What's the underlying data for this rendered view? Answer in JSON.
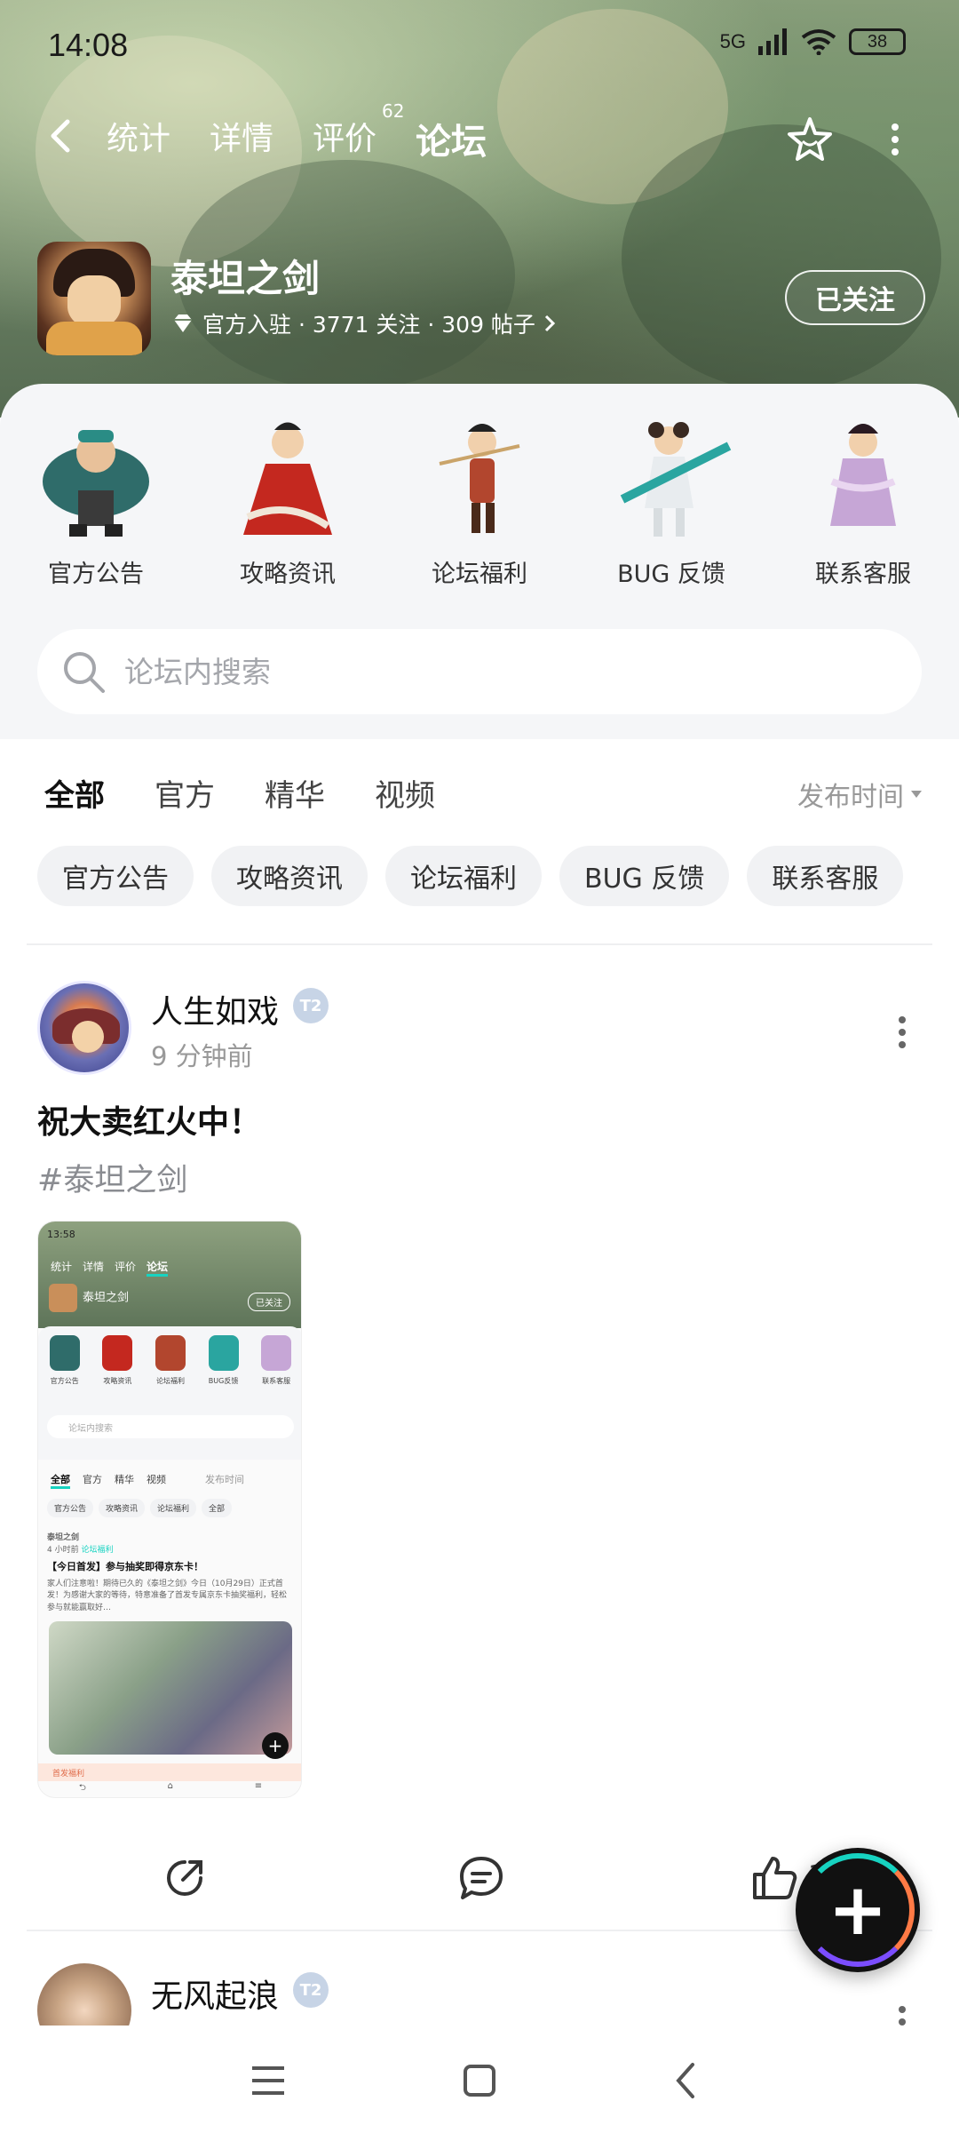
{
  "status": {
    "time": "14:08",
    "network": "5G",
    "battery": "38"
  },
  "nav": {
    "tabs": [
      "统计",
      "详情",
      "评价",
      "论坛"
    ],
    "active_tab": 3,
    "review_count": "62"
  },
  "game": {
    "name": "泰坦之剑",
    "meta": "官方入驻 · 3771 关注 · 309 帖子",
    "follow_label": "已关注"
  },
  "categories": [
    {
      "label": "官方公告"
    },
    {
      "label": "攻略资讯"
    },
    {
      "label": "论坛福利"
    },
    {
      "label": "BUG 反馈"
    },
    {
      "label": "联系客服"
    }
  ],
  "search": {
    "placeholder": "论坛内搜索"
  },
  "filter_tabs": [
    "全部",
    "官方",
    "精华",
    "视频"
  ],
  "sort_label": "发布时间",
  "chips": [
    "官方公告",
    "攻略资讯",
    "论坛福利",
    "BUG 反馈",
    "联系客服"
  ],
  "post": {
    "author": "人生如戏",
    "level": "2",
    "time": "9 分钟前",
    "title": "祝大卖红火中！",
    "tag": "#泰坦之剑",
    "like_count": "1"
  },
  "screenshot": {
    "time": "13:58",
    "tabs": [
      "统计",
      "详情",
      "评价",
      "论坛"
    ],
    "game_name": "泰坦之剑",
    "follow": "已关注",
    "cats": [
      "官方公告",
      "攻略资讯",
      "论坛福利",
      "BUG反馈",
      "联系客服"
    ],
    "search": "论坛内搜索",
    "ftabs": [
      "全部",
      "官方",
      "精华",
      "视频"
    ],
    "sort": "发布时间",
    "chips": [
      "官方公告",
      "攻略资讯",
      "论坛福利",
      "全部"
    ],
    "post_author": "泰坦之剑",
    "post_time": "4 小时前",
    "post_tag": "论坛福利",
    "post_title": "【今日首发】参与抽奖即得京东卡！",
    "post_body": "家人们注意啦！期待已久的《泰坦之剑》今日（10月29日）正式首发！为感谢大家的等待，特意准备了首发专属京东卡抽奖福利，轻松参与就能赢取好…",
    "band": "首发福利"
  },
  "post2": {
    "author": "无风起浪",
    "level": "2"
  },
  "colors": {
    "accent": "#17d3c1"
  }
}
